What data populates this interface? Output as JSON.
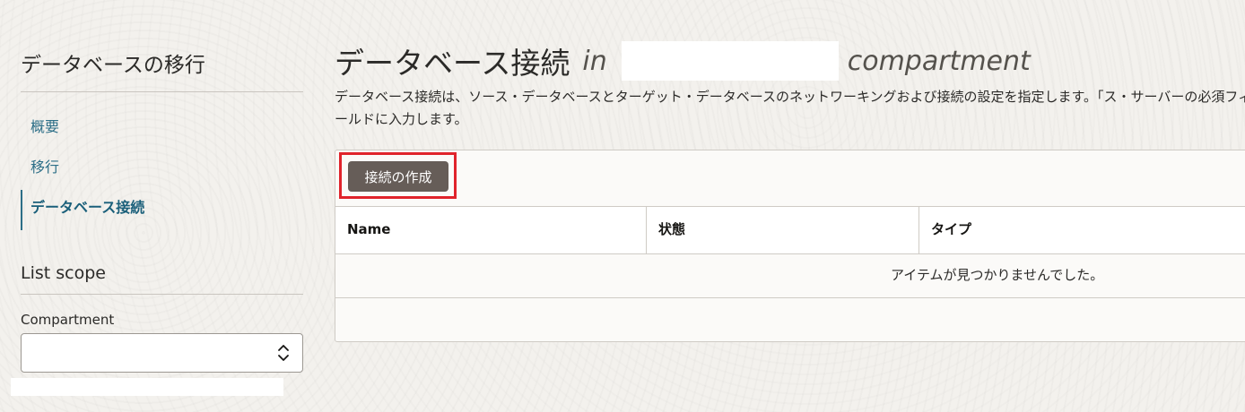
{
  "sidebar": {
    "title": "データベースの移行",
    "nav": [
      {
        "label": "概要",
        "active": false
      },
      {
        "label": "移行",
        "active": false
      },
      {
        "label": "データベース接続",
        "active": true
      }
    ],
    "list_scope": {
      "title": "List scope",
      "compartment_label": "Compartment",
      "compartment_value": ""
    }
  },
  "main": {
    "title": "データベース接続",
    "title_in": "in",
    "title_compartment_name": "",
    "title_compartment": "compartment",
    "description": "データベース接続は、ソース・データベースとターゲット・データベースのネットワーキングおよび接続の設定を指定します。「ス・サーバーの必須フィールドに入力します。",
    "create_button_label": "接続の作成",
    "table": {
      "columns": [
        "Name",
        "状態",
        "タイプ"
      ],
      "empty_message": "アイテムが見つかりませんでした。"
    }
  },
  "colors": {
    "accent": "#2c6e87",
    "button": "#665d58",
    "highlight": "#e0232b",
    "background": "#f3f1ed"
  }
}
